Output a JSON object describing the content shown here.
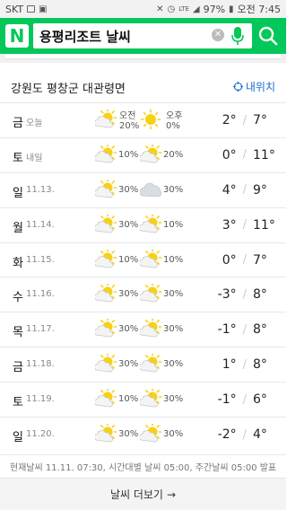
{
  "status_bar": {
    "carrier": "SKT",
    "battery": "97%",
    "time": "오전 7:45",
    "network": "LTE"
  },
  "search": {
    "logo": "N",
    "query": "용평리조트 날씨"
  },
  "location": {
    "name": "강원도 평창군 대관령면",
    "my_location_label": "내위치"
  },
  "labels": {
    "am": "오전",
    "pm": "오후"
  },
  "forecast": [
    {
      "day": "금",
      "date": "오늘",
      "am_icon": "partly-sunny-icon",
      "am_pct": "20%",
      "pm_icon": "sunny-icon",
      "pm_pct": "0%",
      "low": "2°",
      "high": "7°"
    },
    {
      "day": "토",
      "date": "내일",
      "am_icon": "partly-sunny-icon",
      "am_pct": "10%",
      "pm_icon": "partly-sunny-icon",
      "pm_pct": "20%",
      "low": "0°",
      "high": "11°"
    },
    {
      "day": "일",
      "date": "11.13.",
      "am_icon": "partly-sunny-icon",
      "am_pct": "30%",
      "pm_icon": "cloudy-icon",
      "pm_pct": "30%",
      "low": "4°",
      "high": "9°"
    },
    {
      "day": "월",
      "date": "11.14.",
      "am_icon": "partly-sunny-icon",
      "am_pct": "30%",
      "pm_icon": "partly-sunny-icon",
      "pm_pct": "10%",
      "low": "3°",
      "high": "11°"
    },
    {
      "day": "화",
      "date": "11.15.",
      "am_icon": "partly-sunny-icon",
      "am_pct": "10%",
      "pm_icon": "partly-sunny-icon",
      "pm_pct": "10%",
      "low": "0°",
      "high": "7°"
    },
    {
      "day": "수",
      "date": "11.16.",
      "am_icon": "partly-sunny-icon",
      "am_pct": "30%",
      "pm_icon": "partly-sunny-icon",
      "pm_pct": "30%",
      "low": "-3°",
      "high": "8°"
    },
    {
      "day": "목",
      "date": "11.17.",
      "am_icon": "partly-sunny-icon",
      "am_pct": "30%",
      "pm_icon": "partly-sunny-icon",
      "pm_pct": "30%",
      "low": "-1°",
      "high": "8°"
    },
    {
      "day": "금",
      "date": "11.18.",
      "am_icon": "partly-sunny-icon",
      "am_pct": "30%",
      "pm_icon": "partly-sunny-icon",
      "pm_pct": "30%",
      "low": "1°",
      "high": "8°"
    },
    {
      "day": "토",
      "date": "11.19.",
      "am_icon": "partly-sunny-icon",
      "am_pct": "10%",
      "pm_icon": "partly-sunny-icon",
      "pm_pct": "30%",
      "low": "-1°",
      "high": "6°"
    },
    {
      "day": "일",
      "date": "11.20.",
      "am_icon": "partly-sunny-icon",
      "am_pct": "30%",
      "pm_icon": "partly-sunny-icon",
      "pm_pct": "30%",
      "low": "-2°",
      "high": "4°"
    }
  ],
  "footer_note": "현재날씨 11.11. 07:30, 시간대별 날씨 05:00, 주간날씨 05:00 발표",
  "more_button": "날씨 더보기",
  "colors": {
    "brand_green": "#03c75a",
    "link_blue": "#1e6ad6",
    "sun_yellow": "#f7d117"
  }
}
